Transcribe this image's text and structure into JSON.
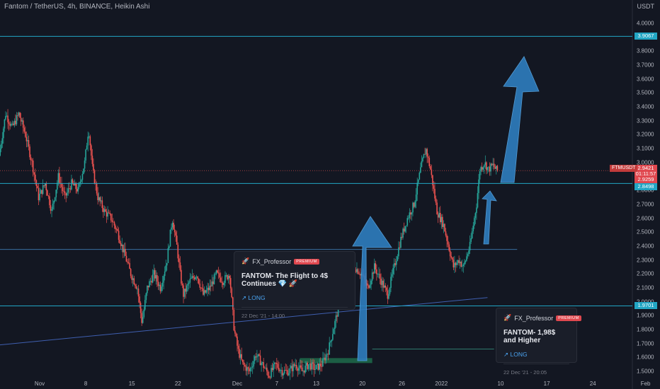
{
  "header": {
    "title": "Fantom / TetherUS, 4h, BINANCE, Heikin Ashi"
  },
  "currency": "USDT",
  "chart_data": {
    "type": "candlestick",
    "title": "Fantom / TetherUS, 4h, BINANCE, Heikin Ashi",
    "ylim": [
      1.45,
      4.05
    ],
    "y_ticks": [
      "4.0000",
      "3.9000",
      "3.8000",
      "3.7000",
      "3.6000",
      "3.5000",
      "3.4000",
      "3.3000",
      "3.2000",
      "3.1000",
      "3.0000",
      "2.9000",
      "2.8000",
      "2.7000",
      "2.6000",
      "2.5000",
      "2.4000",
      "2.3000",
      "2.2000",
      "2.1000",
      "2.0000",
      "1.9000",
      "1.8000",
      "1.7000",
      "1.6000",
      "1.5000"
    ],
    "x_ticks": [
      {
        "label": "Nov",
        "d": 0
      },
      {
        "label": "8",
        "d": 7
      },
      {
        "label": "15",
        "d": 14
      },
      {
        "label": "22",
        "d": 21
      },
      {
        "label": "Dec",
        "d": 30
      },
      {
        "label": "7",
        "d": 36
      },
      {
        "label": "13",
        "d": 42
      },
      {
        "label": "20",
        "d": 49
      },
      {
        "label": "26",
        "d": 55
      },
      {
        "label": "2022",
        "d": 61
      },
      {
        "label": "10",
        "d": 70
      },
      {
        "label": "17",
        "d": 77
      },
      {
        "label": "24",
        "d": 84
      },
      {
        "label": "Feb",
        "d": 92
      }
    ],
    "price_keypoints": [
      [
        -6,
        3.05
      ],
      [
        -5,
        3.35
      ],
      [
        -4,
        3.25
      ],
      [
        -3,
        3.35
      ],
      [
        -2,
        3.2
      ],
      [
        -1,
        3.0
      ],
      [
        0,
        2.75
      ],
      [
        1,
        2.85
      ],
      [
        2,
        2.65
      ],
      [
        3,
        2.9
      ],
      [
        4,
        2.75
      ],
      [
        5,
        2.85
      ],
      [
        6,
        2.8
      ],
      [
        7,
        3.0
      ],
      [
        7.6,
        3.25
      ],
      [
        8.2,
        2.95
      ],
      [
        9,
        2.75
      ],
      [
        10,
        2.65
      ],
      [
        11,
        2.6
      ],
      [
        12,
        2.5
      ],
      [
        13,
        2.35
      ],
      [
        14,
        2.2
      ],
      [
        15,
        2.1
      ],
      [
        15.7,
        1.85
      ],
      [
        16.5,
        2.1
      ],
      [
        17.5,
        2.2
      ],
      [
        18.5,
        2.1
      ],
      [
        19.5,
        2.3
      ],
      [
        20.3,
        2.6
      ],
      [
        21,
        2.4
      ],
      [
        21.5,
        2.2
      ],
      [
        22,
        2.05
      ],
      [
        23,
        2.15
      ],
      [
        24,
        2.2
      ],
      [
        25,
        2.05
      ],
      [
        26,
        2.1
      ],
      [
        27,
        2.2
      ],
      [
        28,
        2.15
      ],
      [
        29,
        2.2
      ],
      [
        29.7,
        1.8
      ],
      [
        30.3,
        1.65
      ],
      [
        31,
        1.55
      ],
      [
        32,
        1.5
      ],
      [
        33,
        1.62
      ],
      [
        34,
        1.55
      ],
      [
        35,
        1.47
      ],
      [
        36,
        1.55
      ],
      [
        37,
        1.5
      ],
      [
        38,
        1.5
      ],
      [
        39,
        1.55
      ],
      [
        40,
        1.5
      ],
      [
        41,
        1.55
      ],
      [
        42,
        1.52
      ],
      [
        43,
        1.55
      ],
      [
        44,
        1.65
      ],
      [
        45,
        1.85
      ],
      [
        46,
        2.05
      ],
      [
        47,
        2.15
      ],
      [
        48,
        2.25
      ],
      [
        49,
        2.2
      ],
      [
        50,
        2.1
      ],
      [
        51,
        2.25
      ],
      [
        52,
        2.15
      ],
      [
        53,
        2.05
      ],
      [
        54,
        2.25
      ],
      [
        55,
        2.45
      ],
      [
        56,
        2.6
      ],
      [
        57,
        2.7
      ],
      [
        58,
        2.95
      ],
      [
        58.8,
        3.1
      ],
      [
        59.5,
        2.95
      ],
      [
        60.5,
        2.65
      ],
      [
        61.5,
        2.55
      ],
      [
        62.5,
        2.35
      ],
      [
        63,
        2.25
      ],
      [
        63.8,
        2.3
      ],
      [
        64.5,
        2.25
      ],
      [
        65.5,
        2.4
      ],
      [
        66.5,
        2.7
      ],
      [
        67,
        2.95
      ],
      [
        67.7,
        3.0
      ],
      [
        68.3,
        2.95
      ],
      [
        69,
        2.98
      ],
      [
        69.6,
        2.94
      ]
    ],
    "current_price": "2.9421",
    "price_tags": [
      {
        "symbol": "FTMUSDT",
        "value": "2.9421"
      },
      {
        "value": "01:11:57"
      },
      {
        "value": "2.9259"
      },
      {
        "value": "2.8498"
      }
    ],
    "horizontal_levels": [
      {
        "value": 3.9067,
        "label": "3.9067"
      },
      {
        "value": 2.8498
      },
      {
        "value": 1.9701,
        "label": "1.9701"
      },
      {
        "value": 2.3756
      },
      {
        "value": 2.9421
      }
    ]
  },
  "cards": [
    {
      "author": "FX_Professor",
      "badge": "PREMIUM",
      "title": "FANTOM- The Flight to 4$ Continues 💎 🚀",
      "direction": "↗ LONG",
      "date": "22 Dec '21 - 14:00"
    },
    {
      "author": "FX_Professor",
      "badge": "PREMIUM",
      "title": "FANTOM- 1,98$ and Higher",
      "direction": "↗ LONG",
      "date": "22 Dec '21 - 20:05"
    }
  ],
  "colors": {
    "up": "#26a69a",
    "down": "#ef5350",
    "level": "#22a6c4",
    "arrow": "#2e7dbf",
    "bg": "#131722"
  }
}
